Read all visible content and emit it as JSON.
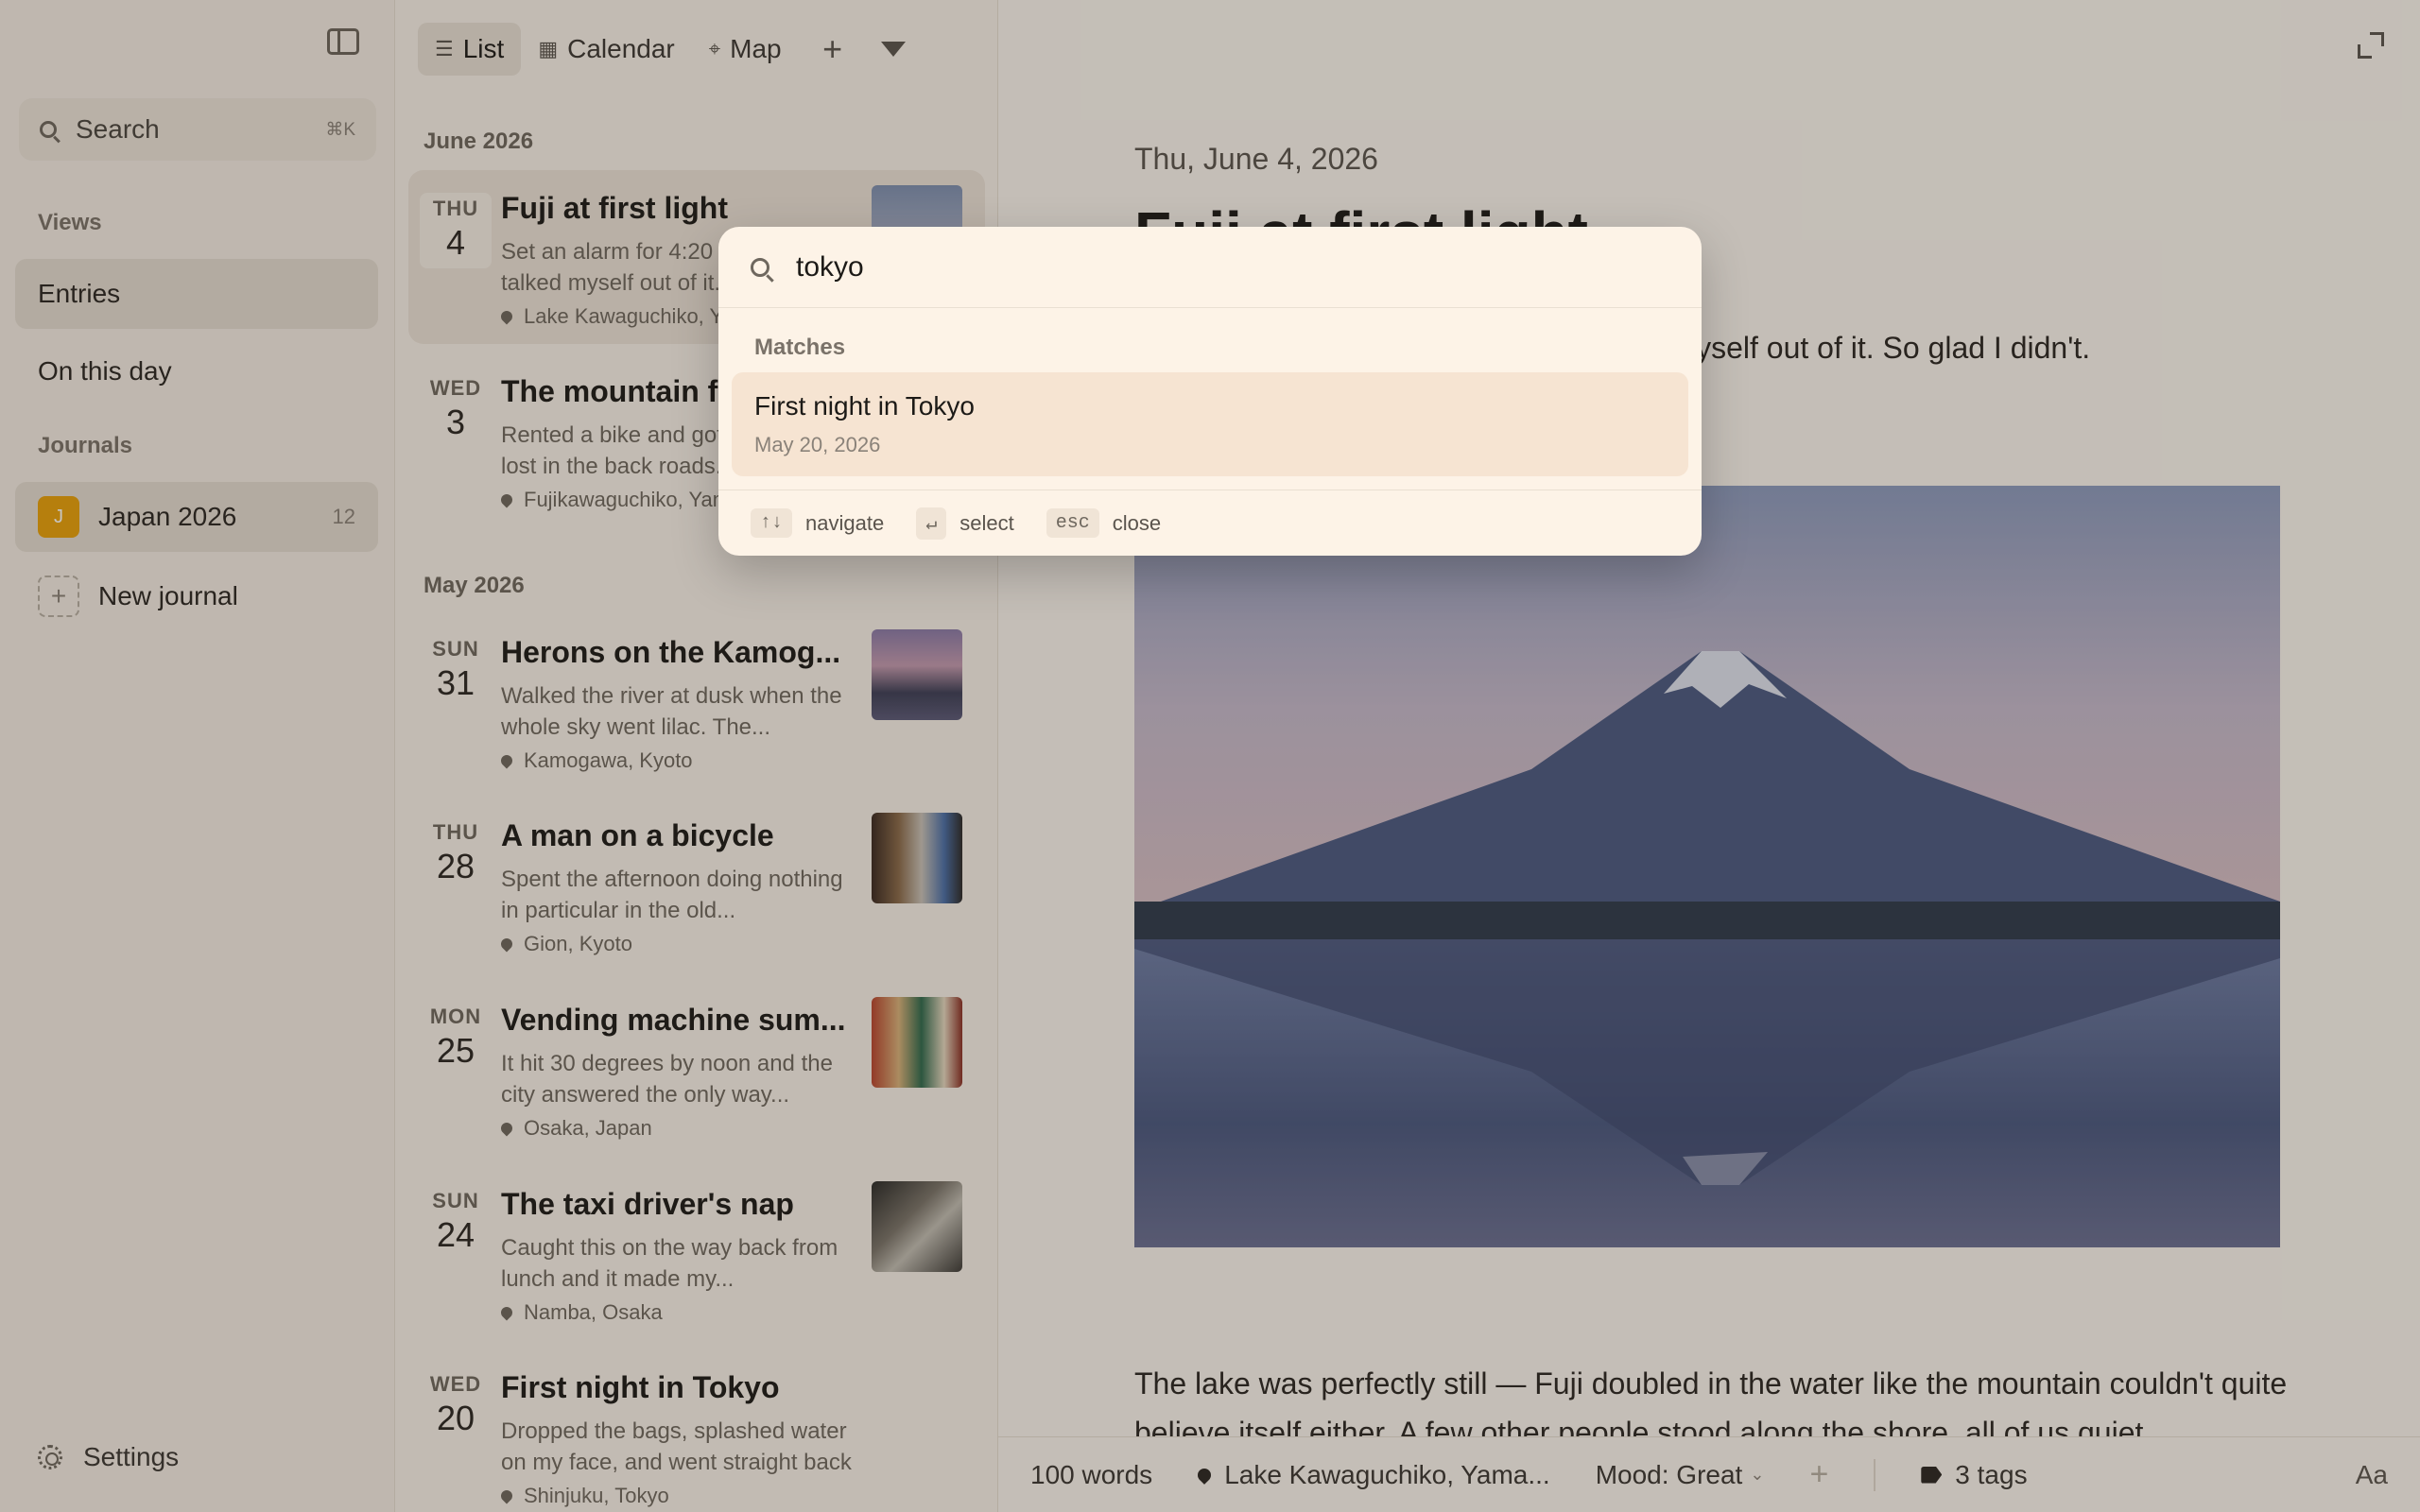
{
  "sidebar": {
    "search_label": "Search",
    "search_shortcut": "⌘K",
    "views_heading": "Views",
    "views": [
      {
        "label": "Entries"
      },
      {
        "label": "On this day"
      }
    ],
    "journals_heading": "Journals",
    "journal": {
      "initial": "J",
      "name": "Japan 2026",
      "count": "12"
    },
    "new_journal": "New journal",
    "settings": "Settings"
  },
  "list": {
    "toolbar": {
      "list": "List",
      "calendar": "Calendar",
      "map": "Map"
    },
    "months": [
      "June 2026",
      "May 2026"
    ],
    "entries": [
      {
        "dow": "THU",
        "day": "4",
        "title": "Fuji at first light",
        "excerpt": "Set an alarm for 4:20 and almost talked myself out of it...",
        "location": "Lake Kawaguchiko, Yamanashi"
      },
      {
        "dow": "WED",
        "day": "3",
        "title": "The mountain from the bike path",
        "excerpt": "Rented a bike and got pleasantly lost in the back roads...",
        "location": "Fujikawaguchiko, Yamanashi"
      },
      {
        "dow": "SUN",
        "day": "31",
        "title": "Herons on the Kamog...",
        "excerpt": "Walked the river at dusk when the whole sky went lilac. The...",
        "location": "Kamogawa, Kyoto"
      },
      {
        "dow": "THU",
        "day": "28",
        "title": "A man on a bicycle",
        "excerpt": "Spent the afternoon doing nothing in particular in the old...",
        "location": "Gion, Kyoto"
      },
      {
        "dow": "MON",
        "day": "25",
        "title": "Vending machine sum...",
        "excerpt": "It hit 30 degrees by noon and the city answered the only way...",
        "location": "Osaka, Japan"
      },
      {
        "dow": "SUN",
        "day": "24",
        "title": "The taxi driver's nap",
        "excerpt": "Caught this on the way back from lunch and it made my...",
        "location": "Namba, Osaka"
      },
      {
        "dow": "WED",
        "day": "20",
        "title": "First night in Tokyo",
        "excerpt": "Dropped the bags, splashed water on my face, and went straight back out — too...",
        "location": "Shinjuku, Tokyo"
      }
    ]
  },
  "main": {
    "date": "Thu, June 4, 2026",
    "title": "Fuji at first light",
    "lead": "Set an alarm for 4:20 and almost talked myself out of it. So glad I didn't.",
    "body": "The lake was perfectly still — Fuji doubled in the water like the mountain couldn't quite believe itself either. A few other people stood along the shore, all of us quiet.",
    "footer": {
      "words": "100 words",
      "location": "Lake Kawaguchiko, Yama...",
      "mood": "Mood: Great",
      "plus": "+",
      "tags": "3 tags",
      "font": "Aa"
    }
  },
  "palette": {
    "query": "tokyo",
    "section": "Matches",
    "result": {
      "title": "First night in Tokyo",
      "date": "May 20, 2026"
    },
    "hints": [
      {
        "key": "↑↓",
        "label": "navigate"
      },
      {
        "key": "↵",
        "label": "select"
      },
      {
        "key": "esc",
        "label": "close"
      }
    ]
  },
  "colors": {
    "accent": "#e8a10a",
    "overlay": "#28201842",
    "palette_bg": "#fdf3e7"
  }
}
